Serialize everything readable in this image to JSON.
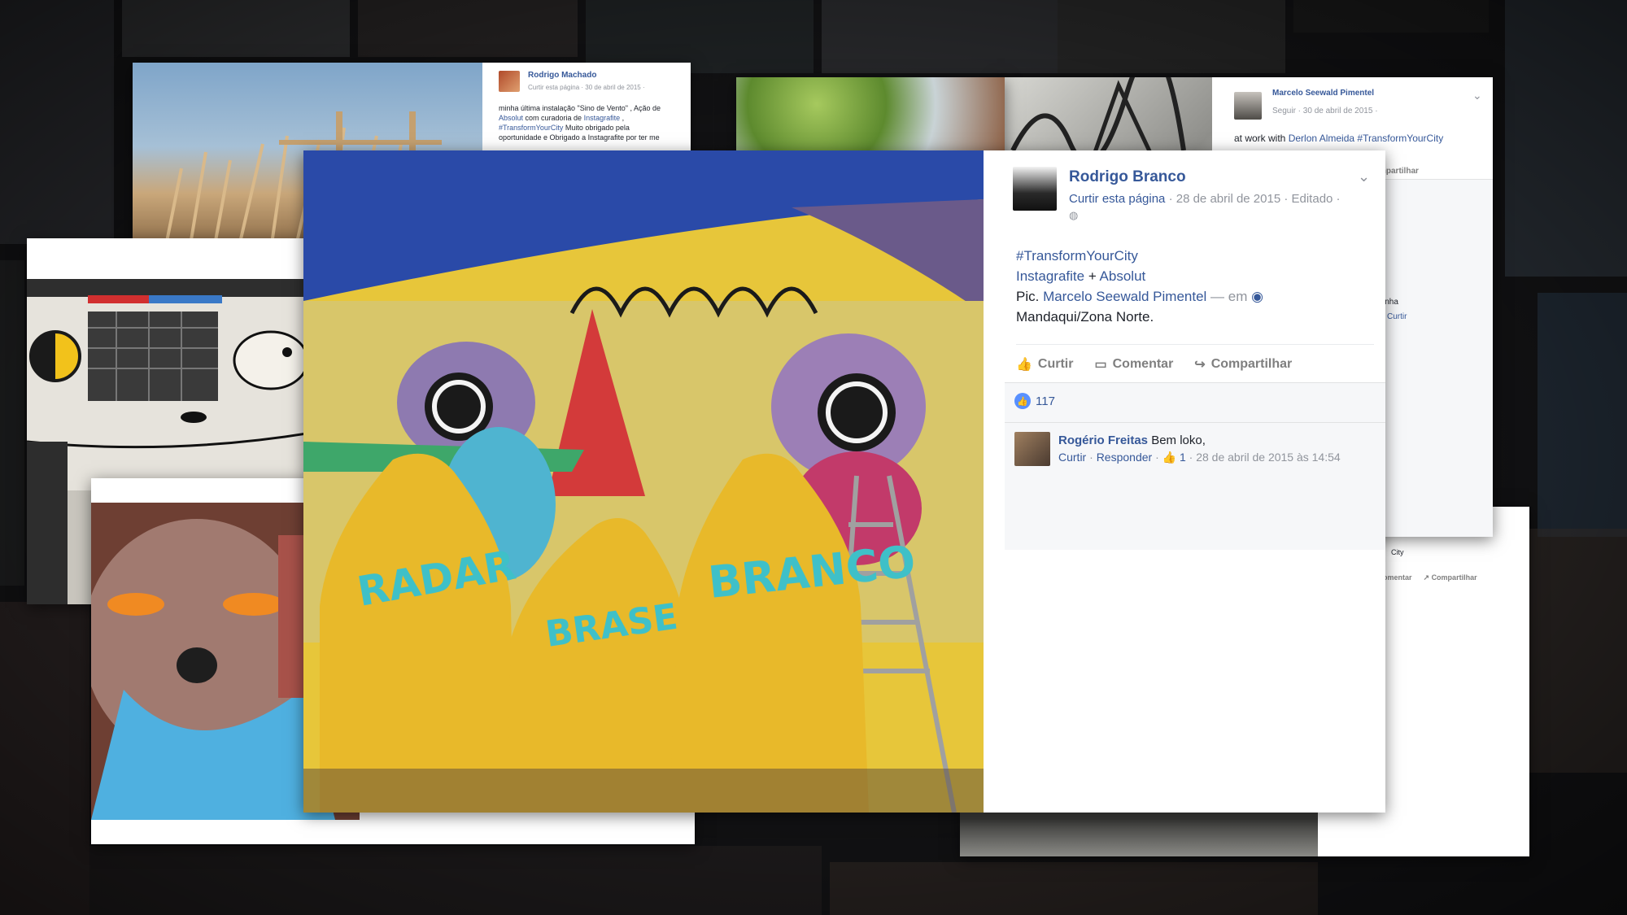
{
  "main_post": {
    "author": "Rodrigo Branco",
    "like_page": "Curtir esta página",
    "meta_rest": " · 28 de abril de 2015 · Editado ·",
    "hashtag": "#TransformYourCity",
    "line2_a": "Instagrafite",
    "line2_b": " + ",
    "line2_c": "Absolut",
    "pic_prefix": "Pic. ",
    "pic_person": "Marcelo Seewald Pimentel",
    "pic_em": " — em ",
    "location": "Mandaqui/Zona Norte",
    "location_end": ".",
    "actions": {
      "like": "Curtir",
      "comment": "Comentar",
      "share": "Compartilhar"
    },
    "like_count": "117",
    "comment": {
      "author": "Rogério Freitas",
      "text": " Bem loko,",
      "like_label": "Curtir",
      "reply_label": "Responder",
      "like_count": "1",
      "date": "· 28 de abril de 2015 às 14:54"
    }
  },
  "post_top_left": {
    "author": "Rodrigo Machado",
    "meta": "Curtir esta página · 30 de abril de 2015 ·",
    "text_1": "minha última instalação \"Sino de Vento\" , Ação de",
    "text_2_link": "Absolut",
    "text_2": " com curadoria de ",
    "text_2_link2": "Instagrafite",
    "text_2_end": " ,",
    "text_3_link": "#TransformYourCity",
    "text_3": " Muito obrigado pela",
    "text_4": "oportunidade e Obrigado a Instagrafite por ter me"
  },
  "post_top_right": {
    "author": "Marcelo Seewald Pimentel",
    "meta": "Seguir · 30 de abril de 2015 ·",
    "text_prefix": "at work with ",
    "text_link": "Derlon Almeida",
    "text_hash": " #TransformYourCity",
    "share_partial": "mpartilhar",
    "side_1": "inha",
    "side_2": "Curtir"
  },
  "post_bottom_right": {
    "hash_partial": "City",
    "comment_partial": "omentar",
    "share": "Compartilhar"
  },
  "colors": {
    "link": "#365899",
    "meta": "#90949c",
    "like_blue": "#5890ff",
    "jacket_yellow": "#e8b92a"
  }
}
